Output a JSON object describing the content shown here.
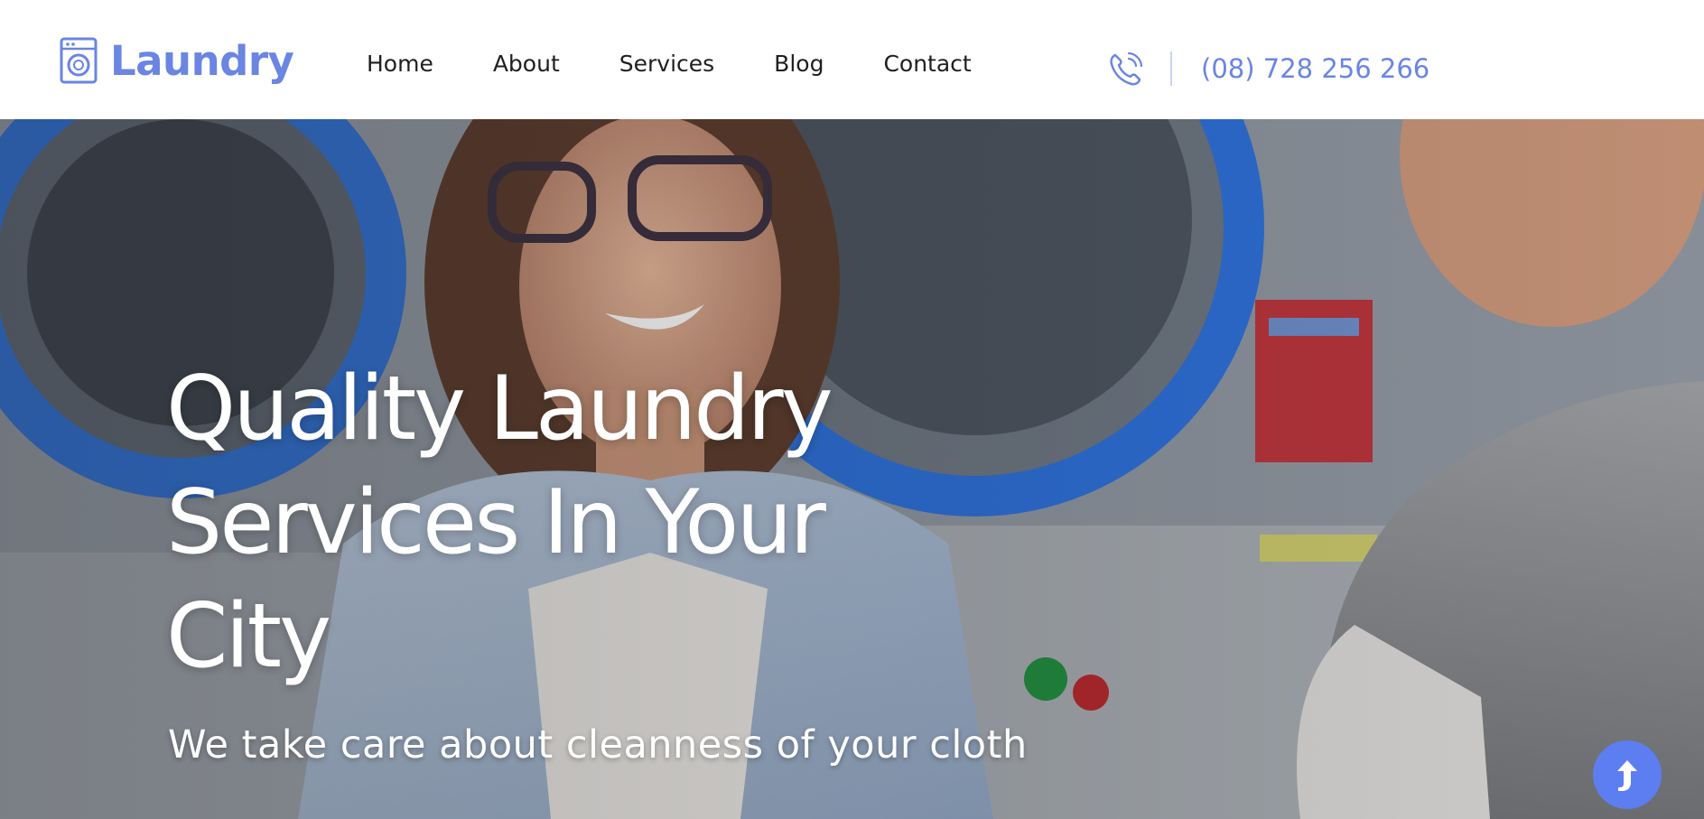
{
  "brand": {
    "name": "Laundry",
    "icon": "washing-machine-icon",
    "color": "#6a85e2"
  },
  "nav": {
    "items": [
      {
        "label": "Home"
      },
      {
        "label": "About"
      },
      {
        "label": "Services"
      },
      {
        "label": "Blog"
      },
      {
        "label": "Contact"
      }
    ]
  },
  "contact": {
    "icon": "phone-icon",
    "phone": "(08) 728 256 266"
  },
  "hero": {
    "title_lines": [
      "Quality Laundry",
      "Services In Your",
      "City"
    ],
    "subtitle": "We take care about cleanness of your cloth",
    "background": "photo of smiling woman with glasses in laundromat with blue washing machines"
  },
  "scroll_top": {
    "icon": "arrow-up-icon",
    "color": "#5d7ef0"
  }
}
